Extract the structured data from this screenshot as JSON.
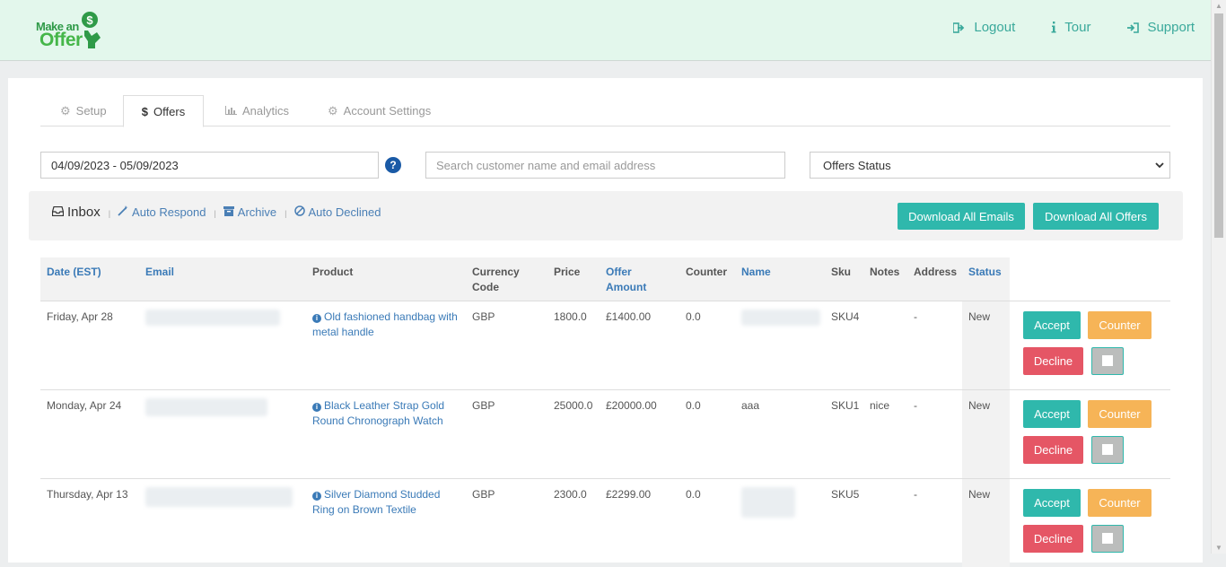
{
  "brand": {
    "line1": "Make an",
    "line2": "Offer"
  },
  "nav": [
    {
      "label": "Logout",
      "icon": "logout-icon"
    },
    {
      "label": "Tour",
      "icon": "info-icon"
    },
    {
      "label": "Support",
      "icon": "sign-in-icon"
    }
  ],
  "tabs": [
    {
      "label": "Setup",
      "icon": "gear-icon",
      "active": false
    },
    {
      "label": "Offers",
      "icon": "dollar-icon",
      "active": true
    },
    {
      "label": "Analytics",
      "icon": "bar-chart-icon",
      "active": false
    },
    {
      "label": "Account Settings",
      "icon": "gear-icon",
      "active": false
    }
  ],
  "filters": {
    "date_range": "04/09/2023 - 05/09/2023",
    "help_glyph": "?",
    "search_placeholder": "Search customer name and email address",
    "status_label": "Offers Status"
  },
  "folders": [
    {
      "label": "Inbox",
      "icon": "inbox-icon",
      "active": true
    },
    {
      "label": "Auto Respond",
      "icon": "magic-wand-icon",
      "active": false
    },
    {
      "label": "Archive",
      "icon": "archive-icon",
      "active": false
    },
    {
      "label": "Auto Declined",
      "icon": "ban-icon",
      "active": false
    }
  ],
  "folder_separator": "|",
  "downloads": {
    "emails": "Download All Emails",
    "offers": "Download All Offers"
  },
  "columns": {
    "date": "Date (EST)",
    "email": "Email",
    "product": "Product",
    "currency": "Currency Code",
    "price": "Price",
    "offer_amount": "Offer Amount",
    "counter": "Counter",
    "name": "Name",
    "sku": "Sku",
    "notes": "Notes",
    "address": "Address",
    "status": "Status"
  },
  "actions": {
    "accept": "Accept",
    "counter": "Counter",
    "decline": "Decline"
  },
  "rows": [
    {
      "date": "Friday, Apr 28",
      "product": "Old fashioned handbag with metal handle",
      "currency": "GBP",
      "price": "1800.0",
      "offer": "£1400.00",
      "counter": "0.0",
      "name": "",
      "sku": "SKU4",
      "notes": "",
      "address": "-",
      "status": "New"
    },
    {
      "date": "Monday, Apr 24",
      "product": "Black Leather Strap Gold Round Chronograph Watch",
      "currency": "GBP",
      "price": "25000.0",
      "offer": "£20000.00",
      "counter": "0.0",
      "name": "aaa",
      "sku": "SKU1",
      "notes": "nice",
      "address": "-",
      "status": "New"
    },
    {
      "date": "Thursday, Apr 13",
      "product": "Silver Diamond Studded Ring on Brown Textile",
      "currency": "GBP",
      "price": "2300.0",
      "offer": "£2299.00",
      "counter": "0.0",
      "name": "",
      "sku": "SKU5",
      "notes": "",
      "address": "-",
      "status": "New"
    }
  ],
  "colors": {
    "accent": "#2fb8ac",
    "counter": "#f6b457",
    "decline": "#e55665",
    "link": "#3a7ab7",
    "header_bg": "#e3f7ec"
  }
}
